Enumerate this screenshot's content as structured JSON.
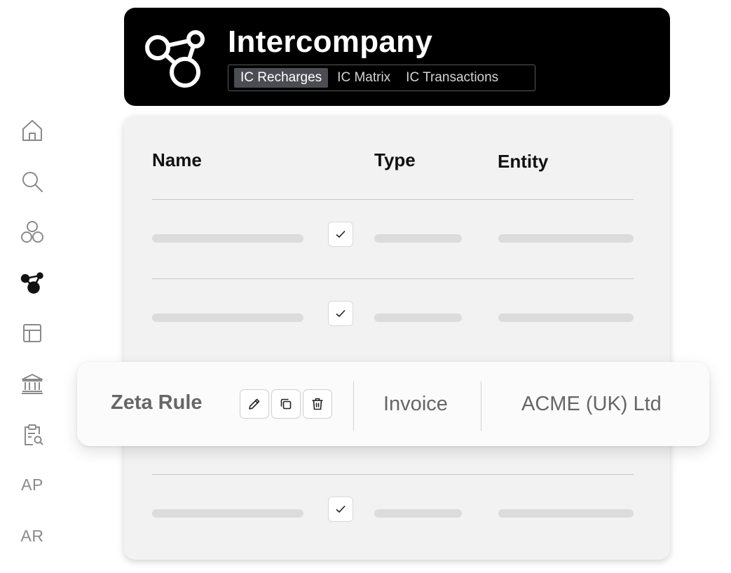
{
  "app": {
    "title": "Intercompany",
    "tabs": [
      {
        "label": "IC Recharges",
        "active": true
      },
      {
        "label": "IC Matrix",
        "active": false
      },
      {
        "label": "IC Transactions",
        "active": false
      }
    ]
  },
  "sidebar": {
    "items": [
      {
        "icon": "home-icon"
      },
      {
        "icon": "search-icon"
      },
      {
        "icon": "circles-icon"
      },
      {
        "icon": "intercompany-icon",
        "active": true
      },
      {
        "icon": "table-icon"
      },
      {
        "icon": "bank-icon"
      },
      {
        "icon": "clipboard-search-icon"
      },
      {
        "label": "AP"
      },
      {
        "label": "AR"
      }
    ]
  },
  "table": {
    "columns": [
      "Name",
      "Type",
      "Entity"
    ],
    "placeholder_rows": 3,
    "highlighted_row": {
      "name": "Zeta Rule",
      "type": "Invoice",
      "entity": "ACME (UK) Ltd",
      "actions": [
        "edit-icon",
        "copy-icon",
        "trash-icon"
      ]
    }
  },
  "colors": {
    "header_bg": "#000000",
    "active_tab_bg": "#4a4d52",
    "card_bg": "#f2f2f2",
    "active_icon": "#111111",
    "inactive_icon": "#8a8a8a"
  }
}
